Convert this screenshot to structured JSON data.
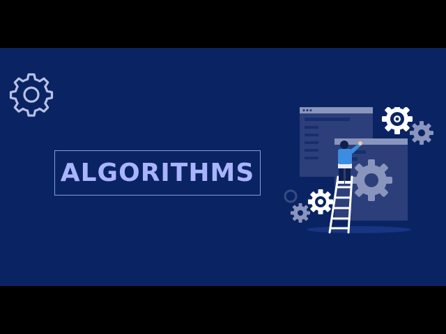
{
  "slide": {
    "title": "ALGORITHMS"
  },
  "icons": {
    "corner": "gear-icon",
    "illustration": "person-on-ladder-with-gears"
  },
  "colors": {
    "background": "#0a2463",
    "letterbox": "#000000",
    "title_text": "#a9b4ff",
    "title_border": "#8c9bd8",
    "gear_outline": "#b8c2e6",
    "window_fill": "#2c3f7a",
    "window_bar": "#8a95bd",
    "person_shirt": "#3a8de0"
  }
}
